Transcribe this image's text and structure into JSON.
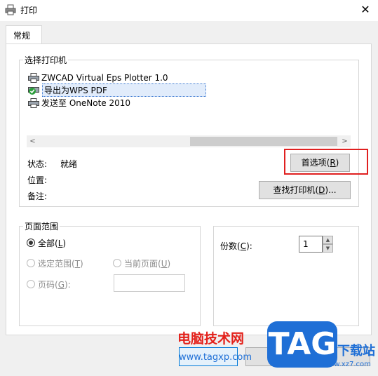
{
  "window": {
    "title": "打印",
    "close_glyph": "✕"
  },
  "tabs": [
    {
      "label": "常规"
    }
  ],
  "printer_group": {
    "label": "选择打印机",
    "printers": [
      {
        "name": "ZWCAD Virtual Eps Plotter 1.0",
        "icon": "printer-icon"
      },
      {
        "name": "导出为WPS PDF",
        "icon": "default-printer-check-icon",
        "selected": true
      },
      {
        "name": "发送至 OneNote 2010",
        "icon": "printer-icon"
      }
    ],
    "scroll_left": "<",
    "scroll_right": ">"
  },
  "status": {
    "status_label": "状态:",
    "status_value": "就绪",
    "location_label": "位置:",
    "comment_label": "备注:"
  },
  "buttons": {
    "preferences": {
      "text": "首选项(",
      "key": "R",
      "suffix": ")"
    },
    "find_printer": {
      "text": "查找打印机(",
      "key": "D",
      "suffix": ")..."
    }
  },
  "page_range": {
    "label": "页面范围",
    "all": {
      "text": "全部(",
      "key": "L",
      "suffix": ")"
    },
    "selection": {
      "text": "选定范围(",
      "key": "T",
      "suffix": ")"
    },
    "current_page": {
      "text": "当前页面(",
      "key": "U",
      "suffix": ")"
    },
    "pages": {
      "text": "页码(",
      "key": "G",
      "suffix": "):"
    }
  },
  "copies": {
    "label_text": "份数(",
    "label_key": "C",
    "label_suffix": "):",
    "value": "1",
    "up": "▲",
    "down": "▼"
  },
  "watermark": {
    "site_name": "电脑技术网",
    "url": "www.tagxp.com",
    "tag": "TAG",
    "site2": "下载站",
    "site2_url": "www.xz7.com"
  },
  "colors": {
    "highlight": "#e02020",
    "selection": "#e1ecfb",
    "watermark_blue": "#1f6fd6",
    "watermark_red": "#e4211b"
  }
}
